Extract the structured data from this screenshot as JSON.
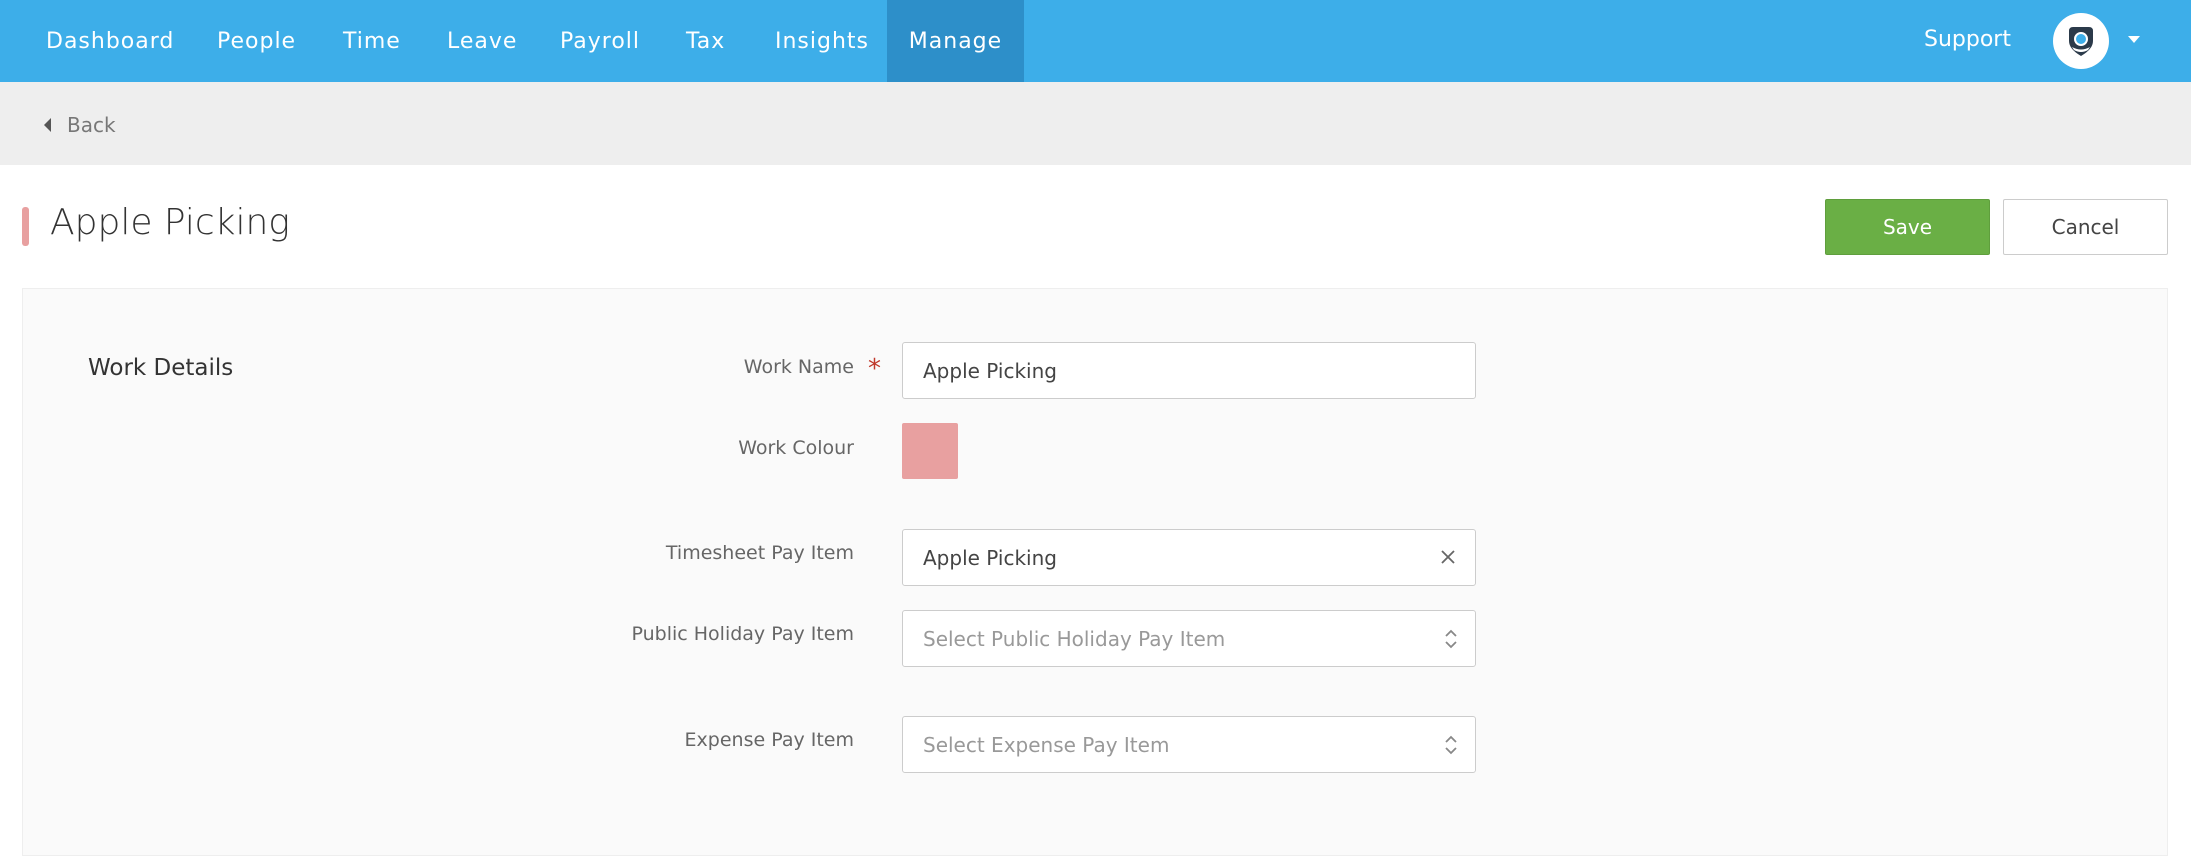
{
  "nav": {
    "items": [
      {
        "label": "Dashboard"
      },
      {
        "label": "People"
      },
      {
        "label": "Time"
      },
      {
        "label": "Leave"
      },
      {
        "label": "Payroll"
      },
      {
        "label": "Tax"
      },
      {
        "label": "Insights"
      },
      {
        "label": "Manage",
        "active": true
      }
    ],
    "support_label": "Support",
    "avatar_icon": "shield-logo-icon",
    "dropdown_icon": "caret-down-icon"
  },
  "backbar": {
    "back_label": "Back",
    "back_icon": "caret-left-icon"
  },
  "page": {
    "title": "Apple Picking",
    "accent_color": "#e8a0a0",
    "save_label": "Save",
    "cancel_label": "Cancel"
  },
  "form": {
    "section_title": "Work Details",
    "work_name": {
      "label": "Work Name",
      "required_mark": "*",
      "value": "Apple Picking"
    },
    "work_colour": {
      "label": "Work Colour",
      "value": "#e8a0a0"
    },
    "timesheet_pay_item": {
      "label": "Timesheet Pay Item",
      "value": "Apple Picking",
      "icon": "clear-icon"
    },
    "public_holiday_pay_item": {
      "label": "Public Holiday Pay Item",
      "placeholder": "Select Public Holiday Pay Item",
      "icon": "up-down-chevron-icon"
    },
    "expense_pay_item": {
      "label": "Expense Pay Item",
      "placeholder": "Select Expense Pay Item",
      "icon": "up-down-chevron-icon"
    }
  },
  "colors": {
    "nav_bg": "#3daee9",
    "nav_active_bg": "#2d8fc9",
    "save_bg": "#6aaf45"
  }
}
